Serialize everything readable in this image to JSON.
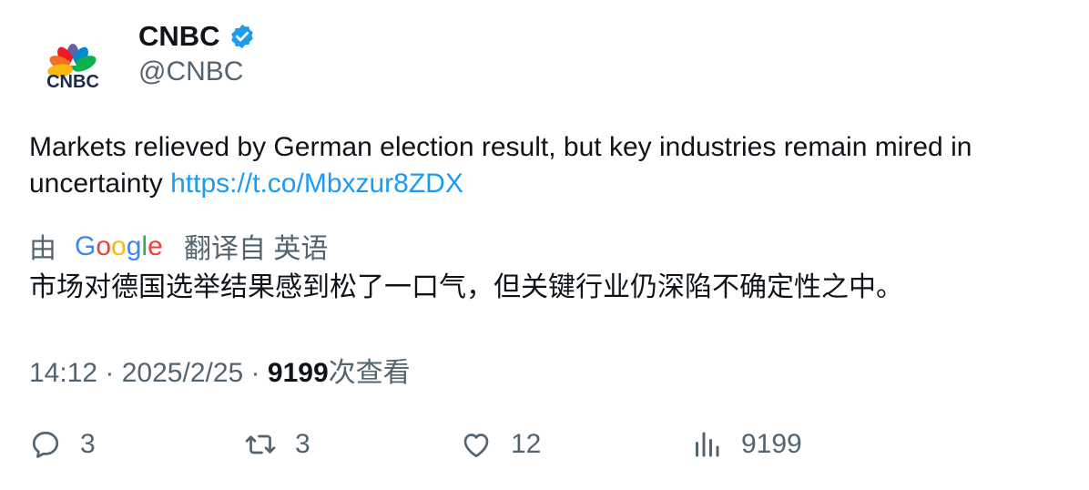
{
  "author": {
    "display_name": "CNBC",
    "handle": "@CNBC",
    "avatar_text": "CNBC",
    "verified_icon": "verified-badge-icon",
    "brand_color": "#1d9bf0"
  },
  "tweet": {
    "text": "Markets relieved by German election result, but key industries remain mired in uncertainty ",
    "link": "https://t.co/Mbxzur8ZDX"
  },
  "translation": {
    "prefix": "由",
    "provider": "Google",
    "suffix": "翻译自 英语",
    "text": "市场对德国选举结果感到松了一口气，但关键行业仍深陷不确定性之中。"
  },
  "meta": {
    "time": "14:12",
    "sep1": " · ",
    "date": "2025/2/25",
    "sep2": " · ",
    "views_count": "9199",
    "views_label": "次查看"
  },
  "actions": {
    "reply": {
      "icon": "reply-icon",
      "count": "3"
    },
    "retweet": {
      "icon": "retweet-icon",
      "count": "3"
    },
    "like": {
      "icon": "heart-icon",
      "count": "12"
    },
    "views": {
      "icon": "analytics-icon",
      "count": "9199"
    }
  }
}
